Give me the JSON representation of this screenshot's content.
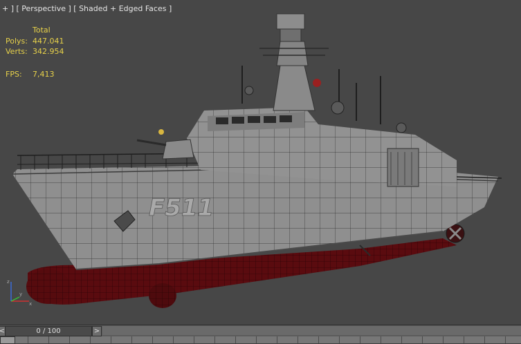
{
  "viewport": {
    "label": "+ ] [ Perspective ] [ Shaded + Edged Faces ]"
  },
  "stats": {
    "header": "Total",
    "polys_label": "Polys:",
    "polys_value": "447.041",
    "verts_label": "Verts:",
    "verts_value": "342.954",
    "fps_label": "FPS:",
    "fps_value": "7,413"
  },
  "model": {
    "hull_number": "F511",
    "colors": {
      "background": "#474747",
      "hull": "#8f8f8f",
      "underwater": "#5a0b0f",
      "stats_text": "#e8d24a"
    }
  },
  "axis_gizmo": {
    "x_label": "x",
    "y_label": "y",
    "z_label": "z"
  },
  "timeline": {
    "frame_label": "0 / 100",
    "prev_icon": "<",
    "next_icon": ">"
  }
}
